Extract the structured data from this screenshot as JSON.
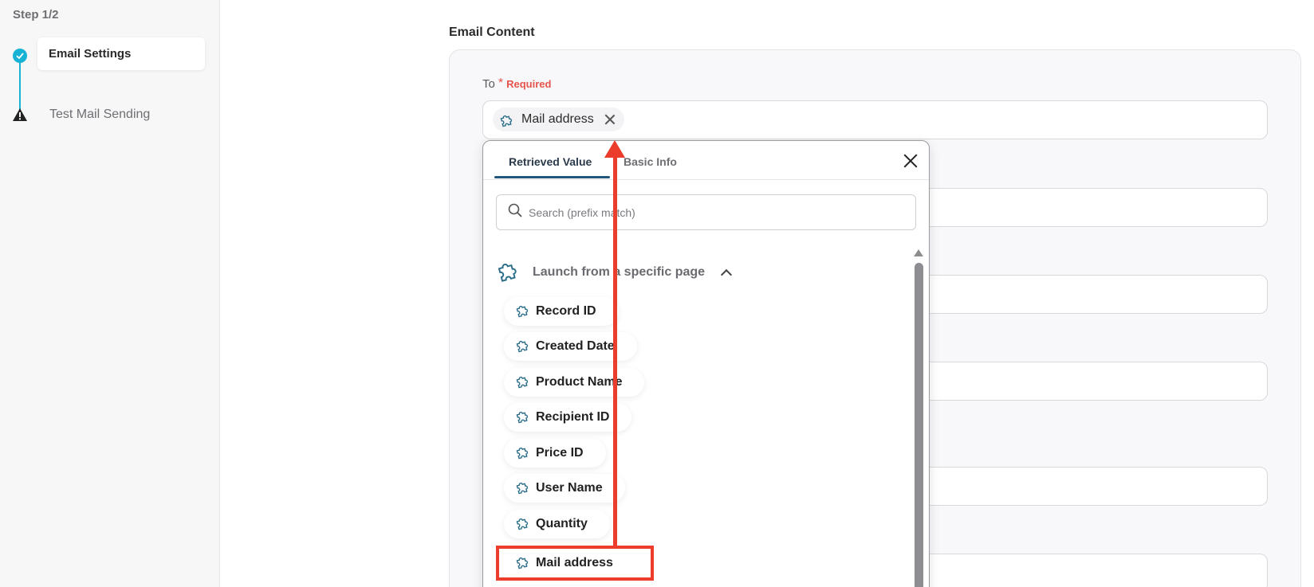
{
  "sidebar": {
    "step_title": "Step 1/2",
    "steps": [
      {
        "label": "Email Settings",
        "status": "done"
      },
      {
        "label": "Test Mail Sending",
        "status": "warning"
      }
    ]
  },
  "main": {
    "section_title": "Email Content",
    "to_field": {
      "label": "To",
      "required_mark": "*",
      "required_text": "Required",
      "chip_label": "Mail address"
    }
  },
  "popup": {
    "tabs": [
      {
        "label": "Retrieved Value",
        "active": true
      },
      {
        "label": "Basic Info",
        "active": false
      }
    ],
    "search_placeholder": "Search (prefix match)",
    "group": {
      "title": "Launch from a specific page",
      "items": [
        "Record ID",
        "Created Date",
        "Product Name",
        "Recipient ID",
        "Price ID",
        "User Name",
        "Quantity",
        "Mail address"
      ],
      "highlighted_item": "Mail address"
    }
  },
  "colors": {
    "accent": "#18b2d4",
    "tab_bar": "#22577a",
    "required": "#e5544b",
    "annotation": "#ec3c2c"
  },
  "icons": {
    "step_done": "check-circle-icon",
    "step_warning": "warning-icon",
    "chip": "puzzle-icon",
    "search": "search-icon",
    "close": "close-icon",
    "collapse": "chevron-up-icon"
  }
}
